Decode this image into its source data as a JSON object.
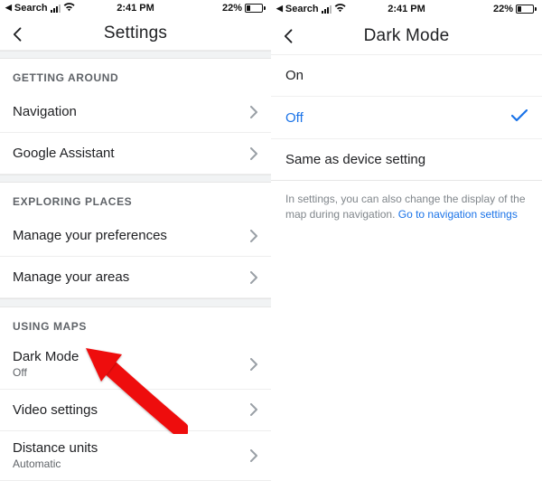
{
  "statusbar": {
    "back_app": "Search",
    "time": "2:41 PM",
    "battery_pct": "22%"
  },
  "left": {
    "title": "Settings",
    "sections": [
      {
        "header": "GETTING AROUND",
        "rows": [
          {
            "label": "Navigation"
          },
          {
            "label": "Google Assistant"
          }
        ]
      },
      {
        "header": "EXPLORING PLACES",
        "rows": [
          {
            "label": "Manage your preferences"
          },
          {
            "label": "Manage your areas"
          }
        ]
      },
      {
        "header": "USING MAPS",
        "rows": [
          {
            "label": "Dark Mode",
            "sub": "Off"
          },
          {
            "label": "Video settings"
          },
          {
            "label": "Distance units",
            "sub": "Automatic"
          }
        ]
      }
    ]
  },
  "right": {
    "title": "Dark Mode",
    "options": [
      {
        "label": "On",
        "selected": false
      },
      {
        "label": "Off",
        "selected": true
      },
      {
        "label": "Same as device setting",
        "selected": false
      }
    ],
    "footer_text": "In settings, you can also change the display of the map during navigation. ",
    "footer_link": "Go to navigation settings"
  }
}
